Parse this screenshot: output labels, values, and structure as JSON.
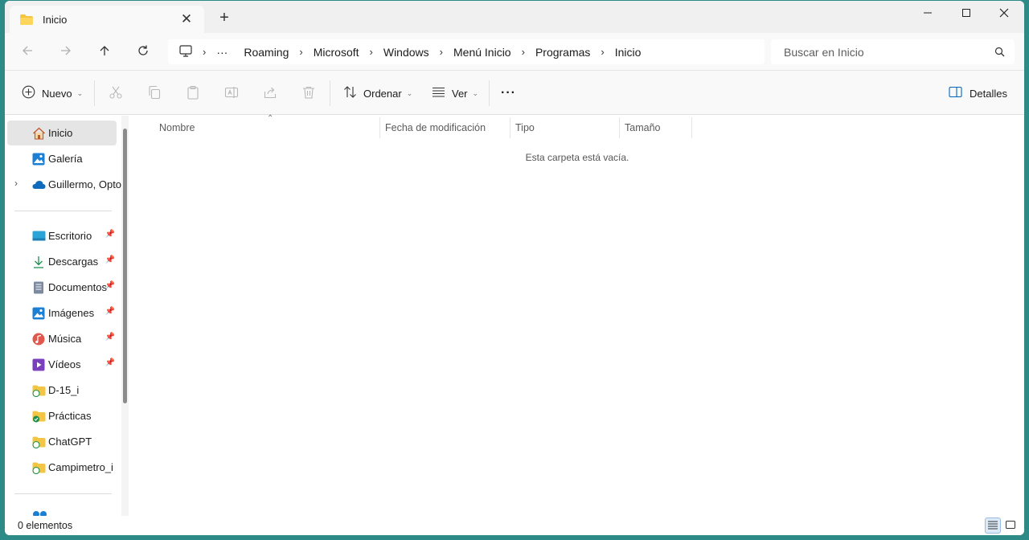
{
  "tab": {
    "title": "Inicio",
    "close_label": "✕",
    "new_tab_label": "+"
  },
  "window_controls": {
    "minimize": "minimize-icon",
    "maximize": "maximize-icon",
    "close": "close-icon"
  },
  "address": {
    "ellipsis": "···",
    "crumbs": [
      "Roaming",
      "Microsoft",
      "Windows",
      "Menú Inicio",
      "Programas",
      "Inicio"
    ]
  },
  "search": {
    "placeholder": "Buscar en Inicio"
  },
  "toolbar": {
    "new_label": "Nuevo",
    "sort_label": "Ordenar",
    "view_label": "Ver",
    "more_label": "···",
    "details_label": "Detalles"
  },
  "sidebar": {
    "items": [
      {
        "label": "Inicio",
        "icon": "home-icon"
      },
      {
        "label": "Galería",
        "icon": "gallery-icon"
      },
      {
        "label": "Guillermo, Opto",
        "icon": "onedrive-icon"
      },
      {
        "label": "Escritorio",
        "icon": "desktop-icon"
      },
      {
        "label": "Descargas",
        "icon": "download-icon"
      },
      {
        "label": "Documentos",
        "icon": "documents-icon"
      },
      {
        "label": "Imágenes",
        "icon": "pictures-icon"
      },
      {
        "label": "Música",
        "icon": "music-icon"
      },
      {
        "label": "Vídeos",
        "icon": "videos-icon"
      },
      {
        "label": "D-15_i",
        "icon": "folder-sync-icon"
      },
      {
        "label": "Prácticas",
        "icon": "folder-synced-icon"
      },
      {
        "label": "ChatGPT",
        "icon": "folder-sync-icon"
      },
      {
        "label": "Campimetro_i",
        "icon": "folder-sync-icon"
      }
    ]
  },
  "columns": [
    "Nombre",
    "Fecha de modificación",
    "Tipo",
    "Tamaño"
  ],
  "empty_message": "Esta carpeta está vacía.",
  "status": {
    "count": "0 elementos"
  },
  "colors": {
    "accent": "#0067c0",
    "folder": "#f4c542",
    "background": "#2d8a87"
  }
}
